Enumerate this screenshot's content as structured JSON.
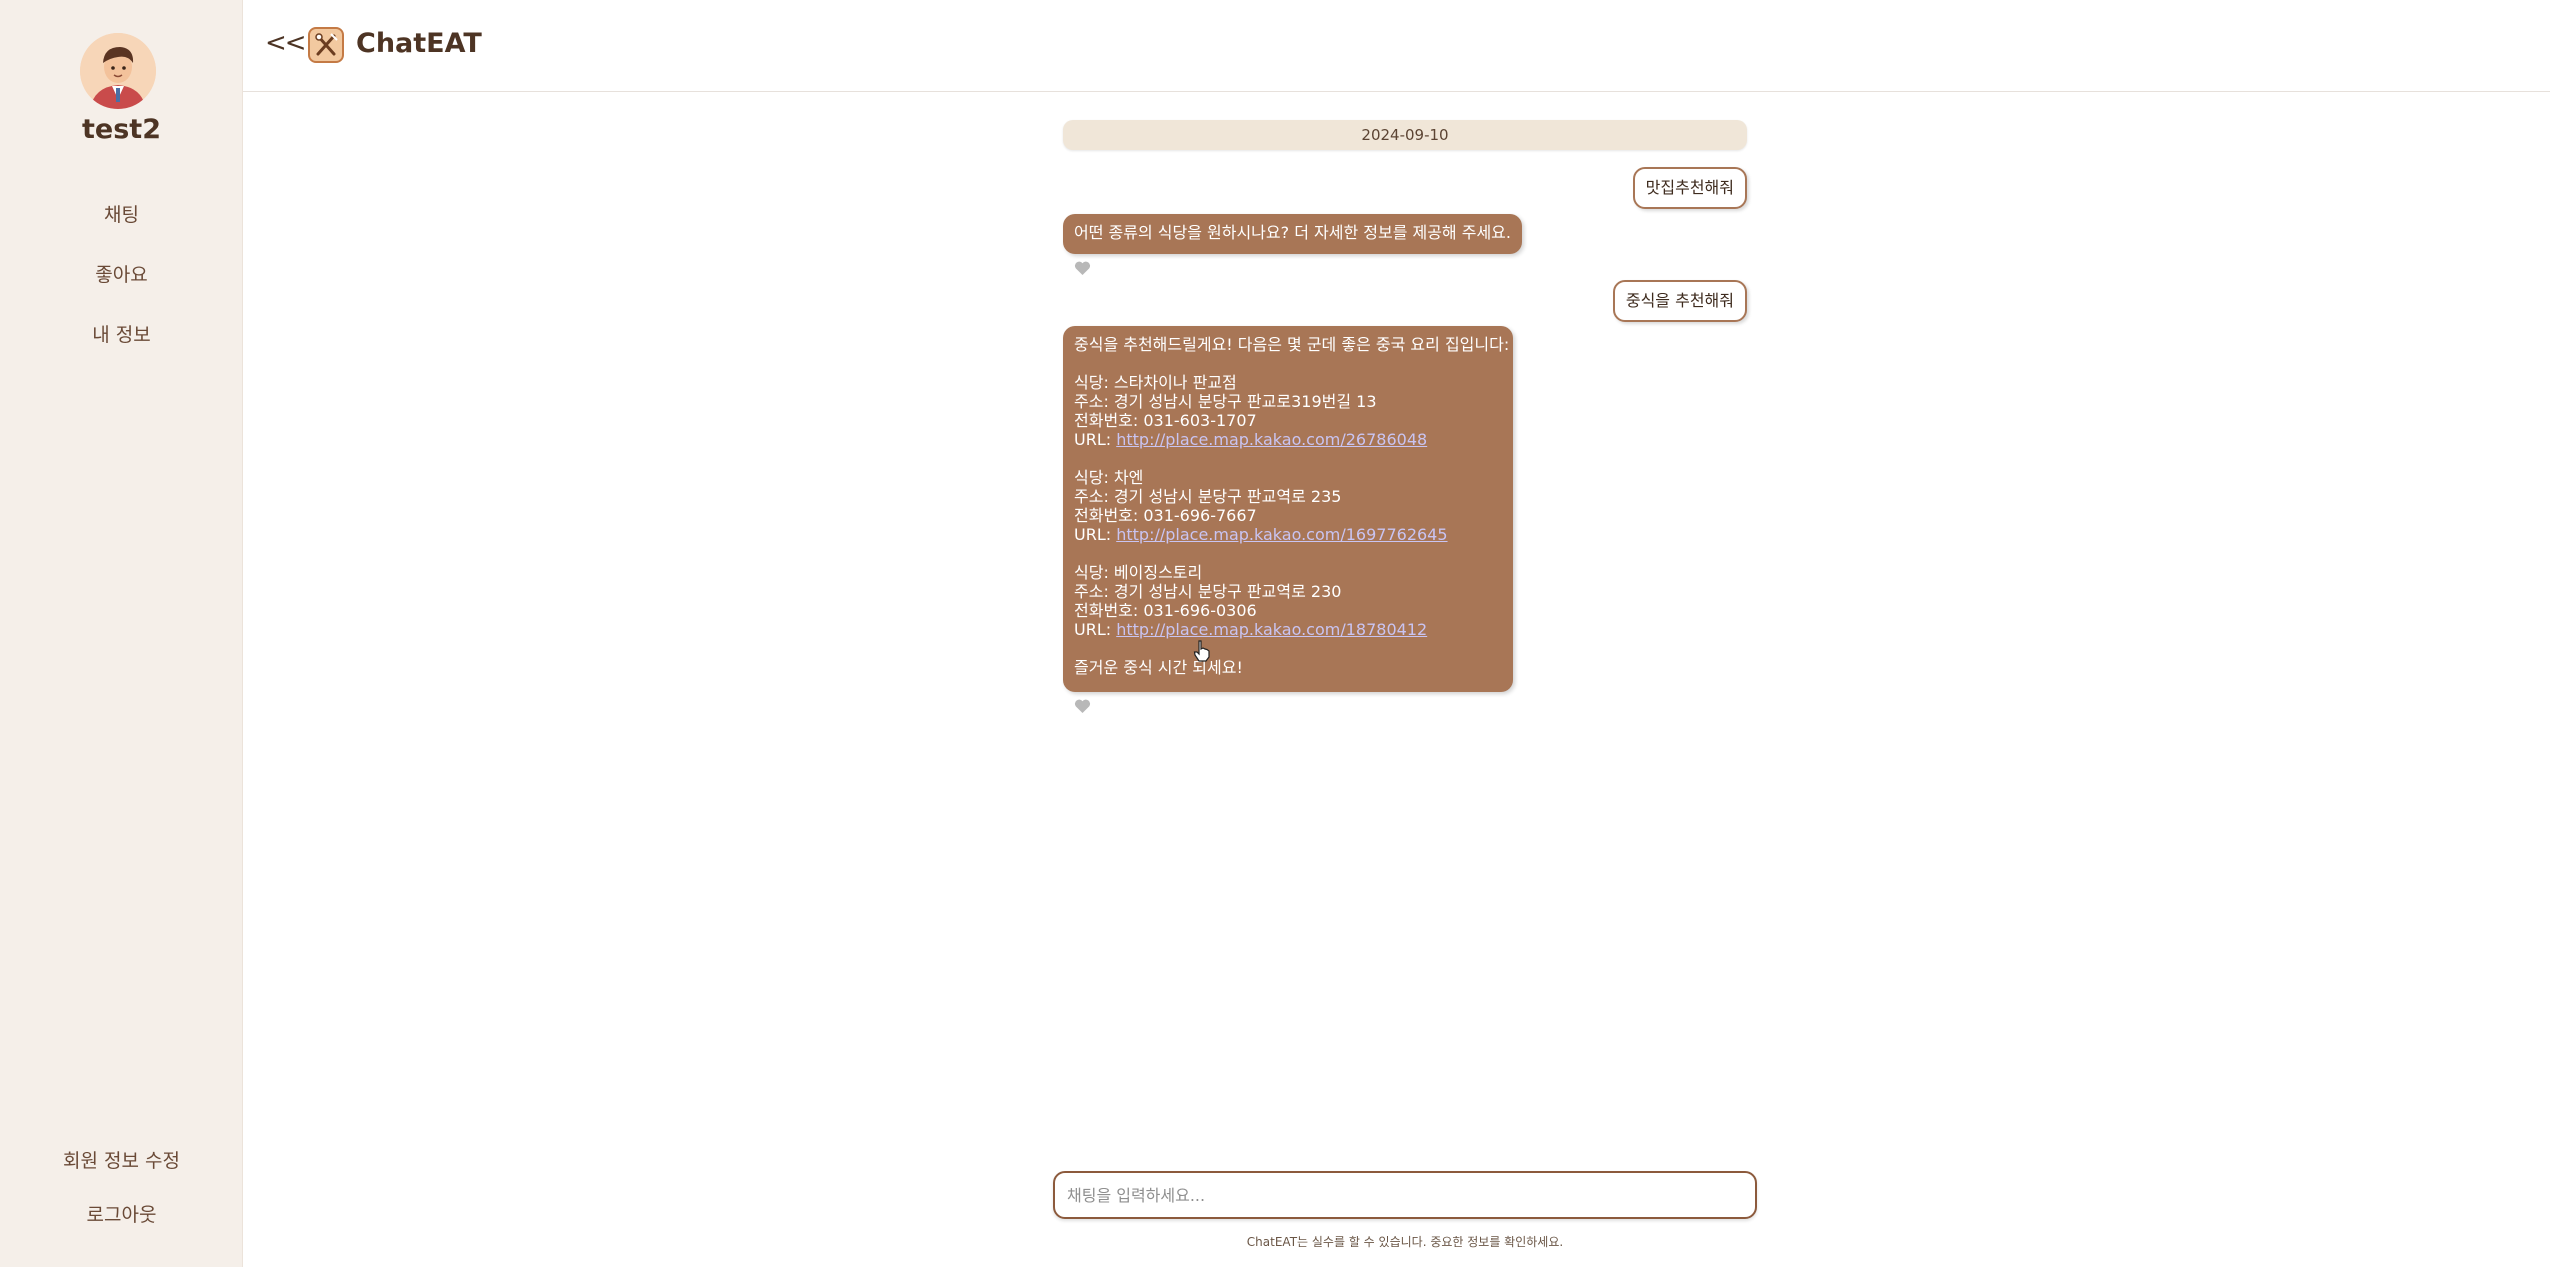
{
  "sidebar": {
    "username": "test2",
    "nav": [
      {
        "label": "채팅"
      },
      {
        "label": "좋아요"
      },
      {
        "label": "내 정보"
      }
    ],
    "bottom": [
      {
        "label": "회원 정보 수정"
      },
      {
        "label": "로그아웃"
      }
    ],
    "avatar_icon": "user-avatar"
  },
  "header": {
    "back_label": "<<",
    "app_title": "ChatEAT",
    "logo_icon": "fork-spoon-logo"
  },
  "chat": {
    "date": "2024-09-10",
    "messages": [
      {
        "role": "user",
        "text": "맛집추천해줘"
      },
      {
        "role": "bot",
        "text": "어떤 종류의 식당을 원하시나요? 더 자세한 정보를 제공해 주세요."
      },
      {
        "role": "user",
        "text": "중식을 추천해줘"
      },
      {
        "role": "bot",
        "intro": "중식을 추천해드릴게요! 다음은 몇 군데 좋은 중국 요리 집입니다:",
        "restaurants": [
          {
            "name": "식당: 스타차이나 판교점",
            "address": "주소: 경기 성남시 분당구 판교로319번길 13",
            "phone": "전화번호: 031-603-1707",
            "url_label": "URL: ",
            "url": "http://place.map.kakao.com/26786048"
          },
          {
            "name": "식당: 차엔",
            "address": "주소: 경기 성남시 분당구 판교역로 235",
            "phone": "전화번호: 031-696-7667",
            "url_label": "URL: ",
            "url": "http://place.map.kakao.com/1697762645"
          },
          {
            "name": "식당: 베이징스토리",
            "address": "주소: 경기 성남시 분당구 판교역로 230",
            "phone": "전화번호: 031-696-0306",
            "url_label": "URL: ",
            "url": "http://place.map.kakao.com/18780412"
          }
        ],
        "outro": "즐거운 중식 시간 되세요!"
      }
    ]
  },
  "input": {
    "placeholder": "채팅을 입력하세요...",
    "value": ""
  },
  "disclaimer": "ChatEAT는 실수를 할 수 있습니다. 중요한 정보를 확인하세요.",
  "colors": {
    "sidebar_bg": "#f5efe9",
    "bubble_brown": "#a87656",
    "date_pill": "#f0e6d8",
    "link": "#c9c4f2",
    "text_dark": "#4d3424"
  }
}
